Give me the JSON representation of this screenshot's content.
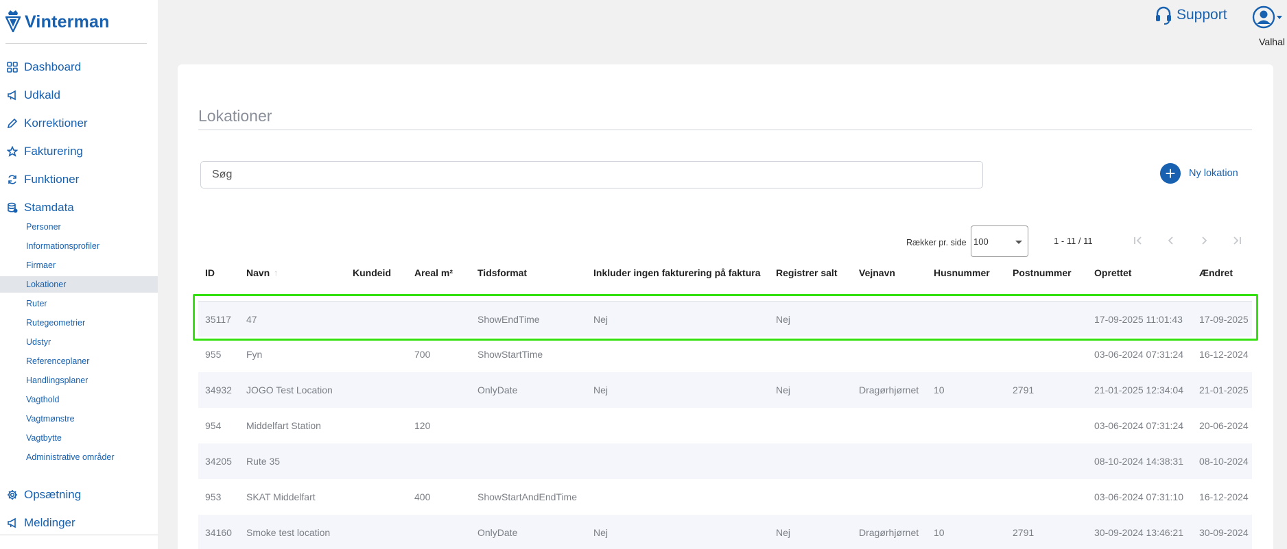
{
  "brand": {
    "name": "Vinterman",
    "color": "#1761b0",
    "logo_icon": "crown-v-logo-icon"
  },
  "sidebar": {
    "nav": [
      {
        "label": "Dashboard",
        "icon": "grid-icon"
      },
      {
        "label": "Udkald",
        "icon": "megaphone-icon"
      },
      {
        "label": "Korrektioner",
        "icon": "pencil-icon"
      },
      {
        "label": "Fakturering",
        "icon": "star-icon"
      },
      {
        "label": "Funktioner",
        "icon": "refresh-icon"
      },
      {
        "label": "Stamdata",
        "icon": "database-icon"
      }
    ],
    "sub": [
      "Personer",
      "Informationsprofiler",
      "Firmaer",
      "Lokationer",
      "Ruter",
      "Rutegeometrier",
      "Udstyr",
      "Referenceplaner",
      "Handlingsplaner",
      "Vagthold",
      "Vagtmønstre",
      "Vagtbytte",
      "Administrative områder"
    ],
    "active_sub": "Lokationer",
    "nav_bottom": [
      {
        "label": "Opsætning",
        "icon": "gear-icon"
      },
      {
        "label": "Meldinger",
        "icon": "megaphone-icon"
      }
    ]
  },
  "header": {
    "support_label": "Support",
    "support_icon": "headset-icon",
    "user_name": "Valhal",
    "user_icon": "account-circle-icon"
  },
  "page": {
    "title": "Lokationer"
  },
  "search": {
    "placeholder": "Søg"
  },
  "actions": {
    "new_location_label": "Ny lokation"
  },
  "pagination": {
    "rows_per_page_label": "Rækker pr. side",
    "rows_per_page_value": "100",
    "range": "1 - 11 / 11"
  },
  "table": {
    "columns": [
      "ID",
      "Navn",
      "Kundeid",
      "Areal m²",
      "Tidsformat",
      "Inkluder ingen fakturering på faktura",
      "Registrer salt",
      "Vejnavn",
      "Husnummer",
      "Postnummer",
      "Oprettet",
      "Ændret"
    ],
    "sort_column": "Navn",
    "rows": [
      [
        "35117",
        "47",
        "",
        "",
        "ShowEndTime",
        "Nej",
        "Nej",
        "",
        "",
        "",
        "17-09-2025 11:01:43",
        "17-09-2025"
      ],
      [
        "955",
        "Fyn",
        "",
        "700",
        "ShowStartTime",
        "",
        "",
        "",
        "",
        "",
        "03-06-2024 07:31:24",
        "16-12-2024"
      ],
      [
        "34932",
        "JOGO Test Location",
        "",
        "",
        "OnlyDate",
        "Nej",
        "Nej",
        "Dragørhjørnet",
        "10",
        "2791",
        "21-01-2025 12:34:04",
        "21-01-2025"
      ],
      [
        "954",
        "Middelfart Station",
        "",
        "120",
        "",
        "",
        "",
        "",
        "",
        "",
        "03-06-2024 07:31:24",
        "20-06-2024"
      ],
      [
        "34205",
        "Rute 35",
        "",
        "",
        "",
        "",
        "",
        "",
        "",
        "",
        "08-10-2024 14:38:31",
        "08-10-2024"
      ],
      [
        "953",
        "SKAT Middelfart",
        "",
        "400",
        "ShowStartAndEndTime",
        "",
        "",
        "",
        "",
        "",
        "03-06-2024 07:31:10",
        "16-12-2024"
      ],
      [
        "34160",
        "Smoke test location",
        "",
        "",
        "OnlyDate",
        "Nej",
        "Nej",
        "Dragørhjørnet",
        "10",
        "2791",
        "30-09-2024 13:46:21",
        "30-09-2024"
      ]
    ]
  },
  "highlight_color": "#35e00f"
}
